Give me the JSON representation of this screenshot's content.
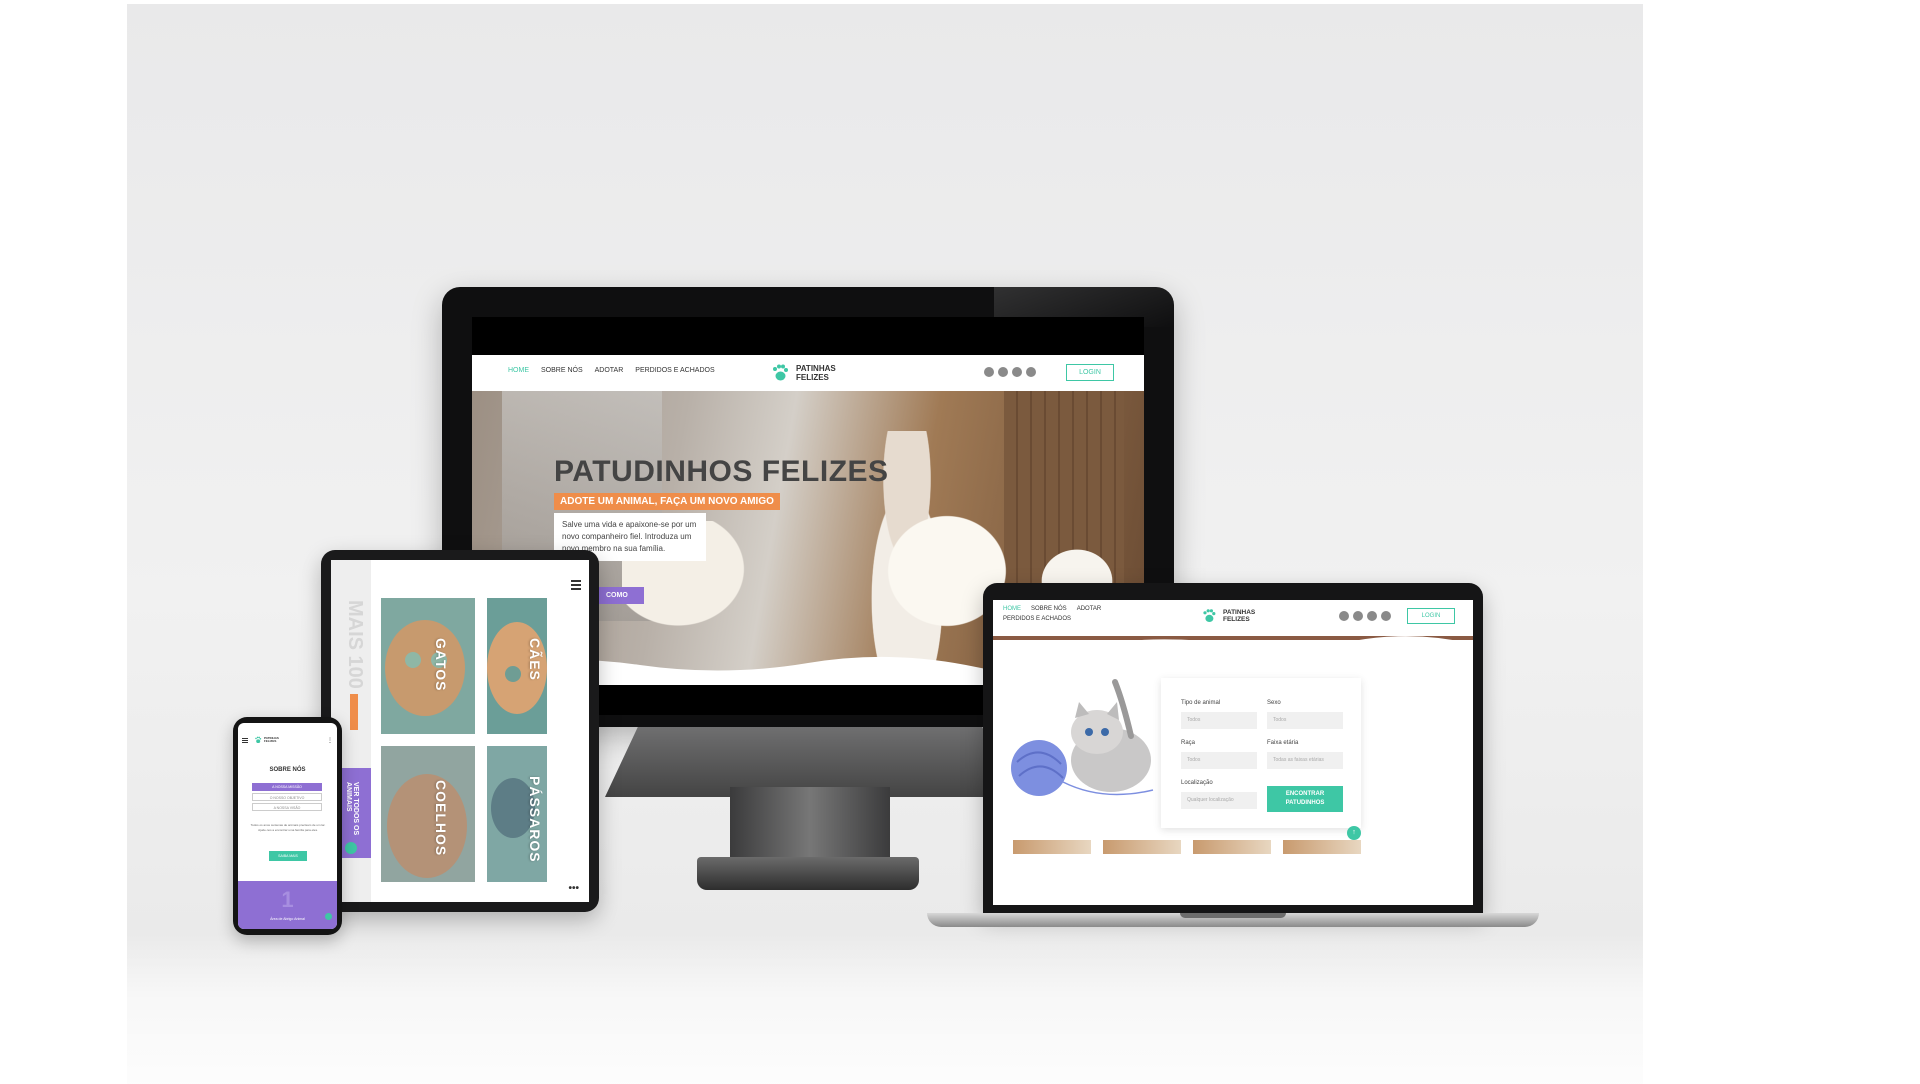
{
  "colors": {
    "accent": "#3ec7a5",
    "orange": "#ef8d4a",
    "purple": "#8e6fd3"
  },
  "brand": {
    "line1": "PATINHAS",
    "line2": "FELIZES",
    "icon": "paw-icon"
  },
  "nav": {
    "home": "HOME",
    "about": "SOBRE NÓS",
    "adopt": "ADOTAR",
    "lost": "PERDIDOS E ACHADOS",
    "login": "LOGIN"
  },
  "social_icons": [
    "instagram-icon",
    "facebook-icon",
    "twitter-icon",
    "google-plus-icon"
  ],
  "monitor": {
    "hero": {
      "title": "PATUDINHOS FELIZES",
      "subtitle": "ADOTE UM ANIMAL, FAÇA UM NOVO AMIGO",
      "description": "Salve uma vida e apaixone-se por um novo companheiro fiel. Introduza um novo membro na sua família.",
      "cta": "COMO"
    }
  },
  "tablet": {
    "side_text": "MAIS 100",
    "band_label": "VER TODOS OS ANIMAIS",
    "tiles": [
      {
        "label": "GATOS"
      },
      {
        "label": "CÃES"
      },
      {
        "label": "COELHOS"
      },
      {
        "label": "PÁSSAROS"
      }
    ],
    "more": "•••"
  },
  "phone": {
    "title": "SOBRE NÓS",
    "pills": [
      "A NOSSA MISSÃO",
      "O NOSSO OBJETIVO",
      "A NOSSA VISÃO"
    ],
    "text": "Todos os anos centenas de animais precisam de um lar. Ajude-nos a encontrar uma família para eles.",
    "button": "SAIBA MAIS",
    "band_number": "1",
    "band_label": "Área de Abrigo Animal"
  },
  "laptop": {
    "search": {
      "animal_type": {
        "label": "Tipo de animal",
        "placeholder": "Todos"
      },
      "sex": {
        "label": "Sexo",
        "placeholder": "Todos"
      },
      "breed": {
        "label": "Raça",
        "placeholder": "Todos"
      },
      "age": {
        "label": "Faixa etária",
        "placeholder": "Todas as faixas etárias"
      },
      "location": {
        "label": "Localização",
        "placeholder": "Qualquer localização"
      },
      "button": "ENCONTRAR PATUDINHOS"
    },
    "fab": "↑"
  }
}
